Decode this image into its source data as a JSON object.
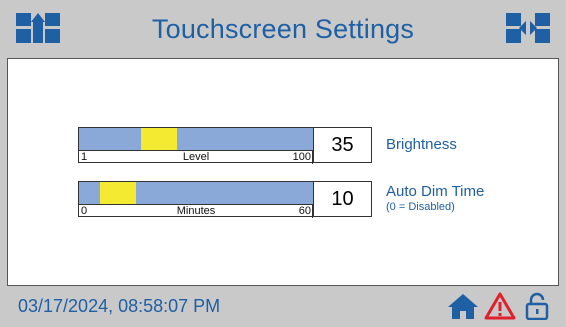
{
  "header": {
    "title": "Touchscreen Settings",
    "left_icon": "nav-up-icon",
    "right_icon": "nav-arrows-icon"
  },
  "settings": [
    {
      "value": "35",
      "label": "Brightness",
      "sublabel": "",
      "scale_min": "1",
      "scale_max": "100",
      "scale_label": "Level",
      "level": 35
    },
    {
      "value": "10",
      "label": "Auto Dim Time",
      "sublabel": "(0 = Disabled)",
      "scale_min": "0",
      "scale_max": "60",
      "scale_label": "Minutes",
      "level": 10
    }
  ],
  "footer": {
    "datetime": "03/17/2024, 08:58:07 PM",
    "icons": [
      "home-icon",
      "alarm-warning-icon",
      "unlocked-padlock-icon"
    ]
  },
  "colors": {
    "accent": "#1f5fa3",
    "background": "#c9c9c9",
    "slider_track": "#8aa8d8",
    "slider_thumb": "#f5ea32",
    "warning": "#e0202a"
  }
}
